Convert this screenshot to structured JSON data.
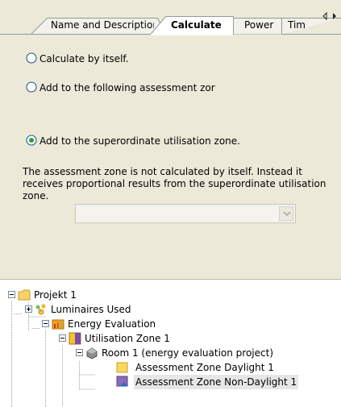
{
  "tabs": [
    {
      "label": "Name and Description",
      "active": false
    },
    {
      "label": "Calculate",
      "active": true
    },
    {
      "label": "Power",
      "active": false
    },
    {
      "label": "Tim",
      "active": false
    }
  ],
  "tab_scroll_icons": [
    "chevron-left-icon",
    "chevron-right-icon"
  ],
  "calculate": {
    "options": [
      {
        "label": "Calculate by itself.",
        "checked": false
      },
      {
        "label": "Add to the following assessment zor",
        "checked": false
      },
      {
        "label": "Add to the superordinate utilisation zone.",
        "checked": true
      }
    ],
    "combo_value": "",
    "description": "The assessment zone is not calculated by itself. Instead it receives proportional results from the superordinate utilisation zone."
  },
  "tree": {
    "nodes": [
      {
        "label": "Projekt 1",
        "icon": "folder-icon",
        "expander": "minus"
      },
      {
        "label": "Luminaires Used",
        "icon": "luminaires-icon",
        "expander": "plus"
      },
      {
        "label": "Energy Evaluation",
        "icon": "energy-icon",
        "expander": "minus"
      },
      {
        "label": "Utilisation Zone 1",
        "icon": "zone-icon",
        "expander": "minus"
      },
      {
        "label": "Room 1 (energy evaluation project)",
        "icon": "room-icon",
        "expander": "minus"
      },
      {
        "label": "Assessment Zone Daylight 1",
        "icon": "daylight-zone-icon",
        "expander": "none"
      },
      {
        "label": "Assessment Zone Non-Daylight 1",
        "icon": "nondaylight-zone-icon",
        "expander": "none",
        "selected": true
      }
    ]
  },
  "colors": {
    "panel_bg": "#ece9d8",
    "tab_active_bg": "#ffffff",
    "tab_inactive_bg": "#f2f1ea",
    "radio_dot": "#2f9e3a",
    "selection_bg": "#e6e6e6",
    "folder": "#f6d36a"
  }
}
